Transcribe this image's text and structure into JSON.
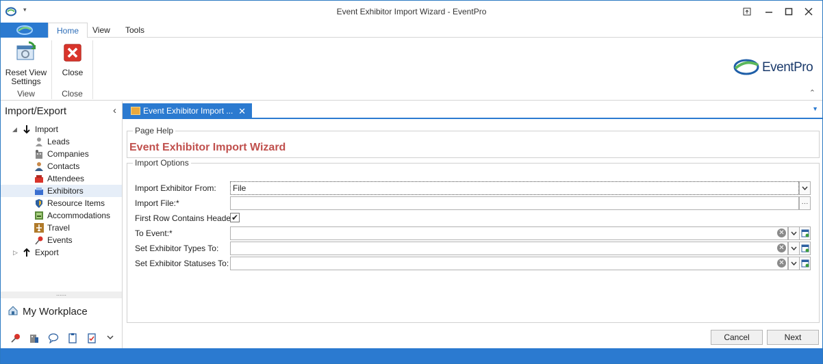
{
  "window": {
    "title": "Event Exhibitor Import Wizard - EventPro"
  },
  "ribbon": {
    "tabs": [
      {
        "label": "Home",
        "active": true
      },
      {
        "label": "View",
        "active": false
      },
      {
        "label": "Tools",
        "active": false
      }
    ],
    "groups": [
      {
        "label": "View",
        "button": "Reset View Settings",
        "button_line1": "Reset View",
        "button_line2": "Settings"
      },
      {
        "label": "Close",
        "button": "Close"
      }
    ],
    "logo_text": "EventPro"
  },
  "left_nav": {
    "header": "Import/Export",
    "tree": [
      {
        "label": "Import",
        "level": 0,
        "icon": "down-arrow-icon"
      },
      {
        "label": "Leads",
        "level": 1,
        "icon": "person-icon"
      },
      {
        "label": "Companies",
        "level": 1,
        "icon": "building-icon"
      },
      {
        "label": "Contacts",
        "level": 1,
        "icon": "contact-icon"
      },
      {
        "label": "Attendees",
        "level": 1,
        "icon": "attendee-icon"
      },
      {
        "label": "Exhibitors",
        "level": 1,
        "icon": "exhibitor-icon",
        "selected": true
      },
      {
        "label": "Resource Items",
        "level": 1,
        "icon": "resource-icon"
      },
      {
        "label": "Accommodations",
        "level": 1,
        "icon": "accommodation-icon"
      },
      {
        "label": "Travel",
        "level": 1,
        "icon": "airplane-icon"
      },
      {
        "label": "Events",
        "level": 1,
        "icon": "pin-icon"
      },
      {
        "label": "Export",
        "level": 0,
        "icon": "up-arrow-icon"
      }
    ],
    "workplace": "My Workplace"
  },
  "document_tab": {
    "label": "Event Exhibitor Import ..."
  },
  "page_help": {
    "legend": "Page Help",
    "title": "Event Exhibitor Import Wizard"
  },
  "import_options": {
    "legend": "Import Options",
    "fields": {
      "import_from": {
        "label": "Import Exhibitor From:",
        "value": "File"
      },
      "import_file": {
        "label": "Import File:*",
        "value": ""
      },
      "first_row": {
        "label": "First Row Contains Headers",
        "checked": true,
        "check_glyph": "✔"
      },
      "to_event": {
        "label": "To Event:*",
        "value": ""
      },
      "exhibitor_types": {
        "label": "Set Exhibitor Types To:",
        "value": ""
      },
      "exhibitor_statuses": {
        "label": "Set Exhibitor Statuses To:",
        "value": ""
      }
    }
  },
  "buttons": {
    "cancel": "Cancel",
    "next": "Next"
  },
  "colors": {
    "accent": "#2b7ad0",
    "title_red": "#c0504d"
  }
}
